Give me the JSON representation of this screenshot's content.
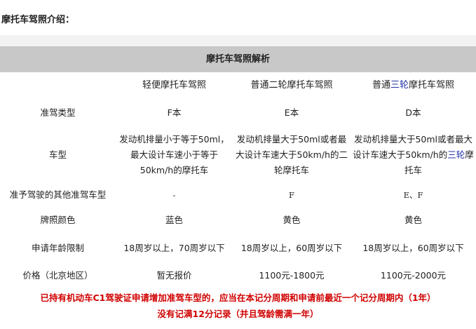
{
  "intro_title": "摩托车驾照介绍：",
  "table_title": "摩托车驾照解析",
  "columns": {
    "c1": "轻便摩托车驾照",
    "c2_pre": "普通二轮摩托车驾照",
    "c3_pre": "普通",
    "c3_hl": "三轮",
    "c3_post": "摩托车驾照"
  },
  "rows": {
    "type": {
      "label": "准驾类型",
      "v1": "F本",
      "v2": "E本",
      "v3": "D本"
    },
    "model": {
      "label": "车型",
      "v1": "发动机排量小于等于50ml，最大设计车速小于等于50km/h的摩托车",
      "v2": "发动机排量大于50ml或者最大设计车速大于50km/h的二轮摩托车",
      "v3_pre": "发动机排量大于50ml或者最大设计车速大于50km/h的",
      "v3_hl": "三轮",
      "v3_post": "摩托车"
    },
    "other": {
      "label": "准予驾驶的其他准驾车型",
      "v1": "-",
      "v2": "F",
      "v3": "E、F"
    },
    "color": {
      "label": "牌照颜色",
      "v1": "蓝色",
      "v2": "黄色",
      "v3": "黄色"
    },
    "age": {
      "label": "申请年龄限制",
      "v1": "18周岁以上，70周岁以下",
      "v2": "18周岁以上，60周岁以下",
      "v3": "18周岁以上，60周岁以下"
    },
    "price": {
      "label": "价格（北京地区）",
      "v1": "暂无报价",
      "v2": "1100元-1800元",
      "v3": "1100元-2000元"
    }
  },
  "notes": {
    "line1": "已持有机动车C1驾驶证申请增加准驾车型的，应当在本记分周期和申请前最近一个记分周期内（1年）",
    "line2": "没有记满12分记录（并且驾龄需满一年）"
  },
  "colors": {
    "note": "#d00000",
    "header_bg": "#c8c8c8",
    "highlight": "#2233aa"
  }
}
